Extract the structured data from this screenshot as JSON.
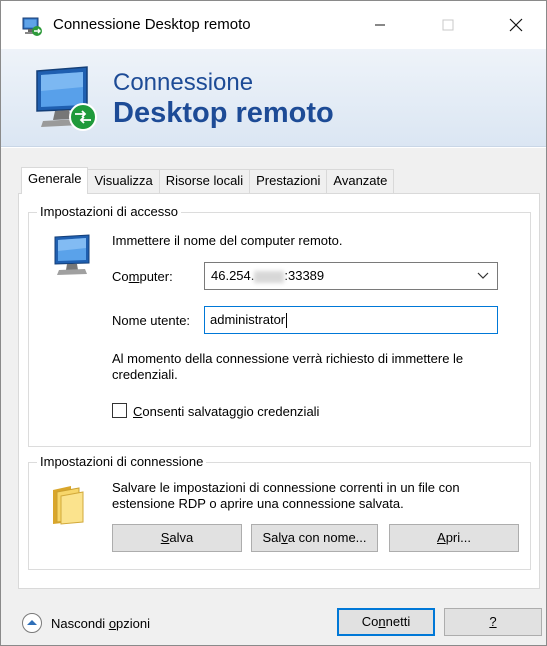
{
  "window": {
    "title": "Connessione Desktop remoto"
  },
  "banner": {
    "line1": "Connessione",
    "line2": "Desktop remoto"
  },
  "tabs": [
    "Generale",
    "Visualizza",
    "Risorse locali",
    "Prestazioni",
    "Avanzate"
  ],
  "access": {
    "legend": "Impostazioni di accesso",
    "prompt": "Immettere il nome del computer remoto.",
    "computer_label_pre": "Co",
    "computer_label_u": "m",
    "computer_label_post": "puter:",
    "computer_value_start": "46.254.",
    "computer_value_end": ":33389",
    "username_label": "Nome utente:",
    "username_value": "administrator",
    "note": "Al momento della connessione verrà richiesto di immettere le credenziali.",
    "checkbox_u": "C",
    "checkbox_label": "onsenti salvataggio credenziali"
  },
  "connection": {
    "legend": "Impostazioni di connessione",
    "description": "Salvare le impostazioni di connessione correnti in un file con estensione RDP o aprire una connessione salvata.",
    "save_u": "S",
    "save_rest": "alva",
    "saveas_pre": "Sal",
    "saveas_u": "v",
    "saveas_post": "a con nome...",
    "open_u": "A",
    "open_rest": "pri..."
  },
  "footer": {
    "toggle_pre": "Nascondi ",
    "toggle_u": "o",
    "toggle_post": "pzioni",
    "connect_pre": "Co",
    "connect_u": "n",
    "connect_post": "netti",
    "help_label": "?"
  },
  "colors": {
    "banner_text": "#1d4b96",
    "focus_border": "#0078d7",
    "button_face": "#e1e1e1"
  }
}
